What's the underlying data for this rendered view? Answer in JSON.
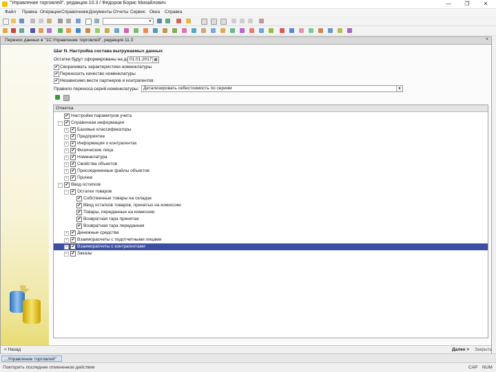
{
  "window": {
    "title": "\"Управление торговлей\", редакция 10.3 / Федоров Борис Михайлович",
    "controls": [
      "—",
      "❐",
      "✕"
    ]
  },
  "menu": [
    "Файл",
    "Правка",
    "Операции",
    "Справочники",
    "Документы",
    "Отчеты",
    "Сервис",
    "Окна",
    "Справка"
  ],
  "document": {
    "title": "Перенос данных в \"1С:Управление торговлей\", редакция 11.3",
    "close": "×"
  },
  "form": {
    "step_title": "Шаг N. Настройка состава выгружаемых данных",
    "date_label": "Остатки будут сформированы на дату:",
    "date_value": "01.01.2017",
    "options": [
      {
        "label": "Сворачивать характеристики номенклатуры",
        "checked": true
      },
      {
        "label": "Переносить качество номенклатуры",
        "checked": true
      },
      {
        "label": "Независимо вести партнеров и контрагентов",
        "checked": true
      }
    ],
    "series_label": "Правило переноса серий номенклатуры:",
    "series_value": "Детализировать себестоимость по сериям"
  },
  "tree": {
    "header": "Отметка",
    "rows": [
      {
        "label": "Настройки параметров учета",
        "level": 0,
        "expander": "",
        "checked": true,
        "selected": false
      },
      {
        "label": "Справочная информация",
        "level": 0,
        "expander": "−",
        "checked": true,
        "selected": false
      },
      {
        "label": "Базовые классификаторы",
        "level": 1,
        "expander": "+",
        "checked": true,
        "selected": false
      },
      {
        "label": "Предприятие",
        "level": 1,
        "expander": "+",
        "checked": true,
        "selected": false
      },
      {
        "label": "Информация о контрагентах",
        "level": 1,
        "expander": "+",
        "checked": true,
        "selected": false
      },
      {
        "label": "Физические лица",
        "level": 1,
        "expander": "+",
        "checked": true,
        "selected": false
      },
      {
        "label": "Номенклатура",
        "level": 1,
        "expander": "+",
        "checked": true,
        "selected": false
      },
      {
        "label": "Свойства объектов",
        "level": 1,
        "expander": "+",
        "checked": true,
        "selected": false
      },
      {
        "label": "Присоединенные файлы объектов",
        "level": 1,
        "expander": "+",
        "checked": true,
        "selected": false
      },
      {
        "label": "Прочее",
        "level": 1,
        "expander": "+",
        "checked": true,
        "selected": false
      },
      {
        "label": "Ввод остатков",
        "level": 0,
        "expander": "−",
        "checked": true,
        "selected": false
      },
      {
        "label": "Остатки товаров",
        "level": 1,
        "expander": "−",
        "checked": true,
        "selected": false
      },
      {
        "label": "Собственные товары на складах",
        "level": 2,
        "expander": "",
        "checked": true,
        "selected": false
      },
      {
        "label": "Ввод остатков товаров, принятых на комиссию",
        "level": 2,
        "expander": "",
        "checked": true,
        "selected": false
      },
      {
        "label": "Товары, переданные на комиссию",
        "level": 2,
        "expander": "",
        "checked": true,
        "selected": false
      },
      {
        "label": "Возвратная тара принятая",
        "level": 2,
        "expander": "",
        "checked": true,
        "selected": false
      },
      {
        "label": "Возвратная тара переданная",
        "level": 2,
        "expander": "",
        "checked": true,
        "selected": false
      },
      {
        "label": "Денежные средства",
        "level": 1,
        "expander": "+",
        "checked": true,
        "selected": false
      },
      {
        "label": "Взаиморасчеты с подотчетными лицами",
        "level": 1,
        "expander": "+",
        "checked": true,
        "selected": false
      },
      {
        "label": "Взаиморасчеты с контрагентами",
        "level": 1,
        "expander": "+",
        "checked": true,
        "selected": true
      },
      {
        "label": "Заказы",
        "level": 1,
        "expander": "+",
        "checked": true,
        "selected": false
      }
    ]
  },
  "footer": {
    "back": "< Назад",
    "next": "Далее >",
    "close": "Закрыть"
  },
  "taskbar": {
    "item": "...Управление торговлей\""
  },
  "status": {
    "message": "Повторить последнее отмененное действие",
    "cap": "CAP",
    "num": "NUM"
  },
  "colors": {
    "selection": "#3d4fa3",
    "panel_yellow": "#e6d96a",
    "accent": "#f2c200"
  }
}
